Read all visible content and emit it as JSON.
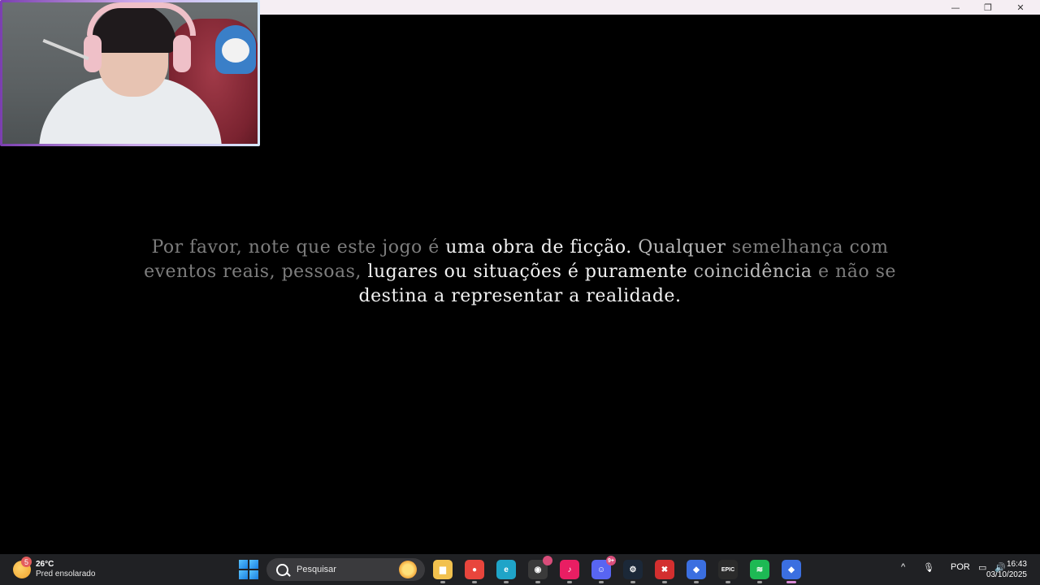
{
  "window": {
    "controls": {
      "minimize": "—",
      "restore": "❐",
      "close": "✕"
    }
  },
  "game": {
    "disclaimer": {
      "segments": [
        {
          "text": "Por favor, note que este jogo é ",
          "tone": "dim"
        },
        {
          "text": "uma obra de ficção.",
          "tone": "bright"
        },
        {
          "text": " Qualquer ",
          "tone": "mid"
        },
        {
          "text": "semelhança com",
          "tone": "dim"
        },
        {
          "text": " eventos reais, pessoas, ",
          "tone": "dim"
        },
        {
          "text": "lugares ou situações é puramente",
          "tone": "bright"
        },
        {
          "text": " coincidência",
          "tone": "mid"
        },
        {
          "text": " e não se",
          "tone": "dim"
        },
        {
          "text": " destina a representar a realidade.",
          "tone": "bright"
        }
      ]
    }
  },
  "taskbar": {
    "weather": {
      "badge": "5",
      "temperature": "26°C",
      "condition": "Pred ensolarado"
    },
    "search": {
      "label": "Pesquisar"
    },
    "apps": [
      {
        "name": "file-explorer",
        "glyph": "▆",
        "color": "#f2c14e"
      },
      {
        "name": "chrome",
        "glyph": "●",
        "color": "#e8453c"
      },
      {
        "name": "edge",
        "glyph": "e",
        "color": "#1fa4c8"
      },
      {
        "name": "obs",
        "glyph": "◉",
        "color": "#3a3a3a",
        "notif": ""
      },
      {
        "name": "tiktok",
        "glyph": "♪",
        "color": "#e91e63"
      },
      {
        "name": "discord",
        "glyph": "☺",
        "color": "#5865f2",
        "notif": "9+"
      },
      {
        "name": "steam",
        "glyph": "⚙",
        "color": "#1b2838"
      },
      {
        "name": "game-app-red",
        "glyph": "✖",
        "color": "#d32f2f"
      },
      {
        "name": "roblox-studio",
        "glyph": "◆",
        "color": "#3b6fe0"
      },
      {
        "name": "epic-games",
        "glyph": "EPIC",
        "color": "#2b2b2b"
      },
      {
        "name": "spotify",
        "glyph": "≋",
        "color": "#1db954"
      },
      {
        "name": "roblox",
        "glyph": "◆",
        "color": "#3b6fe0",
        "active": true
      }
    ],
    "tray": {
      "chevron": "^",
      "mic": "🎙",
      "language": "POR",
      "network": "▭",
      "volume": "🔊",
      "time": "16:43",
      "date": "03/10/2025"
    }
  }
}
